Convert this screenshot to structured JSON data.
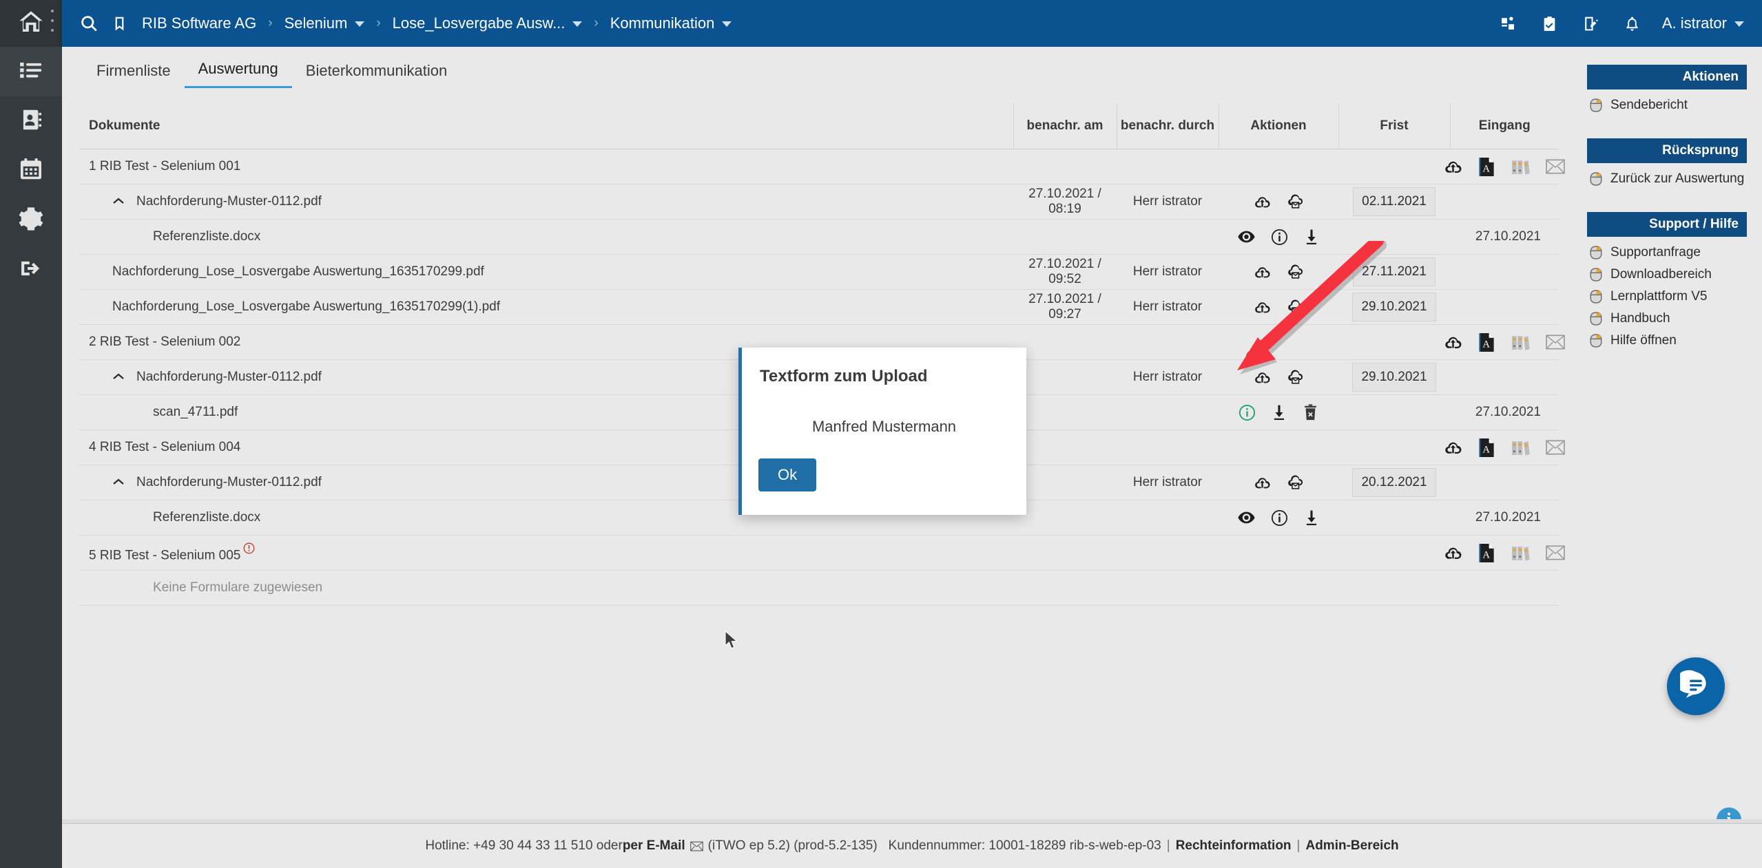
{
  "sidebar": {
    "items": [
      {
        "name": "home",
        "icon": "home-icon"
      },
      {
        "name": "projects",
        "icon": "list-icon"
      },
      {
        "name": "contacts",
        "icon": "address-book-icon"
      },
      {
        "name": "calendar",
        "icon": "calendar-icon"
      },
      {
        "name": "settings",
        "icon": "gear-icon"
      },
      {
        "name": "logout",
        "icon": "logout-icon"
      }
    ]
  },
  "topbar": {
    "search_icon": "search-icon",
    "bookmark_icon": "bookmark-icon",
    "breadcrumbs": [
      {
        "label": "RIB Software AG",
        "caret": false
      },
      {
        "label": "Selenium",
        "caret": true
      },
      {
        "label": "Lose_Losvergabe Ausw...",
        "caret": true
      },
      {
        "label": "Kommunikation",
        "caret": true
      }
    ],
    "icons": [
      "apps-icon",
      "clipboard-check-icon",
      "notepad-edit-icon",
      "bell-icon"
    ],
    "user": "A. istrator",
    "brand_color": "#0a5390"
  },
  "tabs": [
    {
      "label": "Firmenliste",
      "active": false
    },
    {
      "label": "Auswertung",
      "active": true
    },
    {
      "label": "Bieterkommunikation",
      "active": false
    }
  ],
  "table": {
    "headers": [
      "Dokumente",
      "benachr. am",
      "benachr. durch",
      "Aktionen",
      "Frist",
      "Eingang"
    ],
    "rows": [
      {
        "type": "group",
        "doc": "1 RIB Test - Selenium 001",
        "benachr_am": "",
        "benachr_durch": "",
        "frist": "",
        "eingang": "",
        "group_actions": [
          "cloud-upload-icon",
          "pdf-icon",
          "binders-icon",
          "envelope-icon"
        ]
      },
      {
        "type": "level1",
        "doc": "Nachforderung-Muster-0112.pdf",
        "benachr_am": "27.10.2021 / 08:19",
        "benachr_durch": "Herr istrator",
        "actions": [
          "cloud-upload-icon",
          "cloud-mail-icon"
        ],
        "frist": "02.11.2021",
        "eingang": ""
      },
      {
        "type": "level2",
        "doc": "Referenzliste.docx",
        "benachr_am": "",
        "benachr_durch": "",
        "actions": [
          "eye-icon",
          "info-icon",
          "download-icon"
        ],
        "frist": "",
        "eingang": "27.10.2021"
      },
      {
        "type": "level1b",
        "doc": "Nachforderung_Lose_Losvergabe Auswertung_1635170299.pdf",
        "benachr_am": "27.10.2021 / 09:52",
        "benachr_durch": "Herr istrator",
        "actions": [
          "cloud-upload-icon",
          "cloud-mail-icon"
        ],
        "frist": "27.11.2021",
        "eingang": ""
      },
      {
        "type": "level1b",
        "doc": "Nachforderung_Lose_Losvergabe Auswertung_1635170299(1).pdf",
        "benachr_am": "27.10.2021 / 09:27",
        "benachr_durch": "Herr istrator",
        "actions": [
          "cloud-upload-icon",
          "cloud-mail-icon"
        ],
        "frist": "29.10.2021",
        "eingang": ""
      },
      {
        "type": "group",
        "doc": "2 RIB Test - Selenium 002",
        "benachr_am": "",
        "benachr_durch": "",
        "frist": "",
        "eingang": "",
        "group_actions": [
          "cloud-upload-icon",
          "pdf-icon",
          "binders-icon",
          "envelope-icon"
        ]
      },
      {
        "type": "level1",
        "doc": "Nachforderung-Muster-0112.pdf",
        "benachr_am": "",
        "benachr_durch": "Herr istrator",
        "actions": [
          "cloud-upload-icon",
          "cloud-mail-icon"
        ],
        "frist": "29.10.2021",
        "eingang": ""
      },
      {
        "type": "level2",
        "doc": "scan_4711.pdf",
        "benachr_am": "",
        "benachr_durch": "",
        "actions": [
          "info-icon-green",
          "download-icon",
          "trash-icon"
        ],
        "frist": "",
        "eingang": "27.10.2021"
      },
      {
        "type": "group",
        "doc": "4 RIB Test - Selenium 004",
        "benachr_am": "",
        "benachr_durch": "",
        "frist": "",
        "eingang": "",
        "group_actions": [
          "cloud-upload-icon",
          "pdf-icon",
          "binders-icon",
          "envelope-icon"
        ]
      },
      {
        "type": "level1",
        "doc": "Nachforderung-Muster-0112.pdf",
        "benachr_am": "",
        "benachr_durch": "Herr istrator",
        "actions": [
          "cloud-upload-icon",
          "cloud-mail-icon"
        ],
        "frist": "20.12.2021",
        "eingang": ""
      },
      {
        "type": "level2",
        "doc": "Referenzliste.docx",
        "benachr_am": "",
        "benachr_durch": "",
        "actions": [
          "eye-icon",
          "info-icon",
          "download-icon"
        ],
        "frist": "",
        "eingang": "27.10.2021"
      },
      {
        "type": "group-warn",
        "doc": "5 RIB Test - Selenium 005",
        "benachr_am": "",
        "benachr_durch": "",
        "frist": "",
        "eingang": "",
        "warn_icon": "warning-info-icon",
        "group_actions": [
          "cloud-upload-icon",
          "pdf-icon",
          "binders-icon",
          "envelope-icon"
        ]
      },
      {
        "type": "empty",
        "doc": "Keine Formulare zugewiesen",
        "benachr_am": "",
        "benachr_durch": "",
        "frist": "",
        "eingang": ""
      }
    ]
  },
  "right_panel": {
    "sections": [
      {
        "title": "Aktionen",
        "items": [
          {
            "label": "Sendebericht",
            "icon": "mouse-click-icon"
          }
        ]
      },
      {
        "title": "Rücksprung",
        "items": [
          {
            "label": "Zurück zur Auswertung",
            "icon": "mouse-click-icon"
          }
        ]
      },
      {
        "title": "Support / Hilfe",
        "items": [
          {
            "label": "Supportanfrage",
            "icon": "mouse-click-icon"
          },
          {
            "label": "Downloadbereich",
            "icon": "mouse-click-icon"
          },
          {
            "label": "Lernplattform V5",
            "icon": "mouse-click-icon"
          },
          {
            "label": "Handbuch",
            "icon": "mouse-click-icon"
          },
          {
            "label": "Hilfe öffnen",
            "icon": "mouse-click-icon"
          }
        ]
      }
    ],
    "header_color": "#0f4c81"
  },
  "modal": {
    "title": "Textform zum Upload",
    "body": "Manfred Mustermann",
    "ok_label": "Ok",
    "accent_color": "#2a6ea6"
  },
  "fab": {
    "icon": "chat-bubble-icon",
    "color": "#0c64a8"
  },
  "info_button": {
    "icon": "info-icon",
    "label": "i",
    "color": "#3a97cf"
  },
  "annotation": {
    "arrow_color": "#f5333f"
  },
  "footer": {
    "hotline_prefix": "Hotline: +49 30 44 33 11 510 oder ",
    "email_label": "per E-Mail",
    "email_icon": "envelope-icon",
    "version": "(iTWO ep 5.2) (prod-5.2-135)",
    "customer": "Kundennummer: 10001-18289 rib-s-web-ep-03",
    "link1": "Rechteinformation",
    "link2": "Admin-Bereich"
  }
}
